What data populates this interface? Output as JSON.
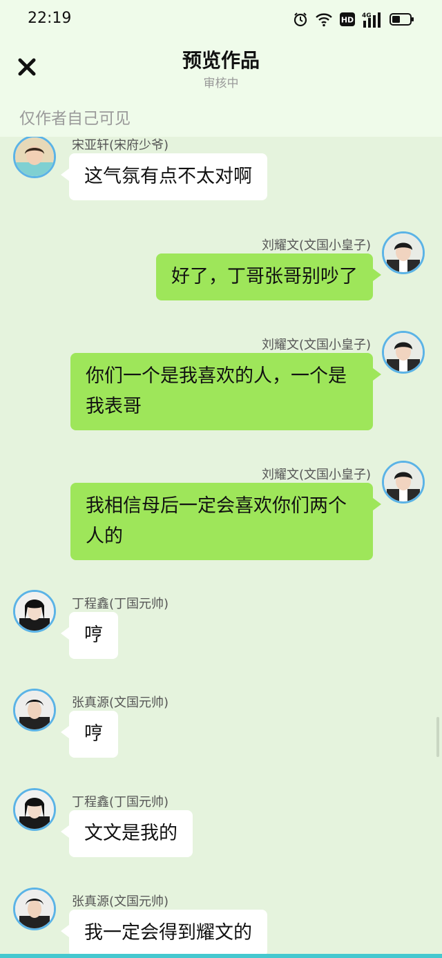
{
  "status_bar": {
    "time": "22:19",
    "icons": [
      "alarm-icon",
      "wifi-icon",
      "hd-icon",
      "signal-4g-icon",
      "battery-icon"
    ],
    "hd_label": "HD",
    "network_label": "4G"
  },
  "header": {
    "title": "预览作品",
    "subtitle": "审核中",
    "visibility_note": "仅作者自己可见",
    "close_icon": "close-icon"
  },
  "messages": [
    {
      "side": "left",
      "sender": "宋亚轩(宋府少爷)",
      "text": "这气氛有点不太对啊"
    },
    {
      "side": "right",
      "sender": "刘耀文(文国小皇子)",
      "text": "好了，丁哥张哥别吵了"
    },
    {
      "side": "right",
      "sender": "刘耀文(文国小皇子)",
      "text": "你们一个是我喜欢的人，一个是我表哥"
    },
    {
      "side": "right",
      "sender": "刘耀文(文国小皇子)",
      "text": "我相信母后一定会喜欢你们两个人的"
    },
    {
      "side": "left",
      "sender": "丁程鑫(丁国元帅)",
      "text": "哼"
    },
    {
      "side": "left",
      "sender": "张真源(文国元帅)",
      "text": "哼"
    },
    {
      "side": "left",
      "sender": "丁程鑫(丁国元帅)",
      "text": "文文是我的"
    },
    {
      "side": "left",
      "sender": "张真源(文国元帅)",
      "text": "我一定会得到耀文的"
    }
  ],
  "colors": {
    "background": "#e5f3dd",
    "header_background": "#effbea",
    "own_bubble": "#9ee65a",
    "other_bubble": "#ffffff",
    "avatar_ring": "#5bb3e6"
  }
}
